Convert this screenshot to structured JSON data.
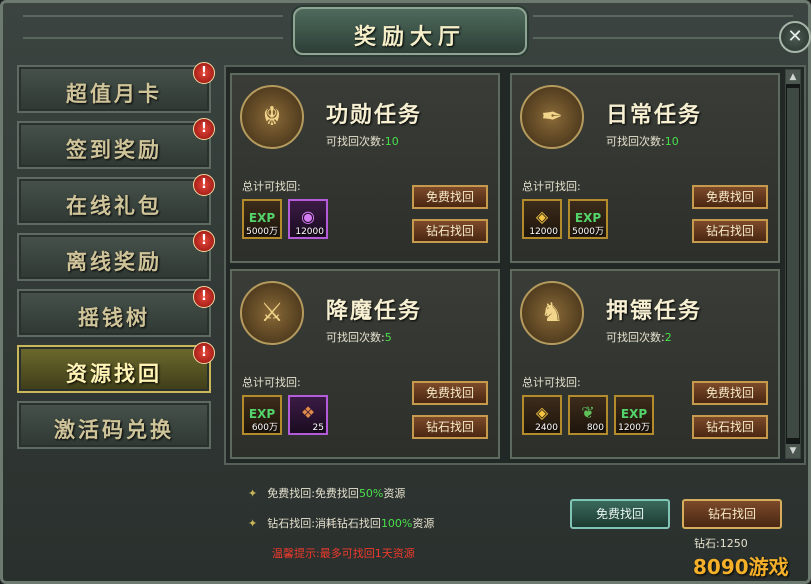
{
  "window": {
    "title": "奖励大厅",
    "close_glyph": "✕"
  },
  "sidebar": {
    "alert_glyph": "!",
    "items": [
      {
        "label": "超值月卡",
        "active": false
      },
      {
        "label": "签到奖励",
        "active": false
      },
      {
        "label": "在线礼包",
        "active": false
      },
      {
        "label": "离线奖励",
        "active": false
      },
      {
        "label": "摇钱树",
        "active": false
      },
      {
        "label": "资源找回",
        "active": true
      },
      {
        "label": "激活码兑换",
        "active": false
      }
    ]
  },
  "cards": [
    {
      "title": "功勋任务",
      "icon": "dragon-mask-icon",
      "count_label": "可找回次数:",
      "count": "10",
      "total_label": "总计可找回:",
      "rewards": [
        {
          "name": "exp-icon",
          "glyph": "EXP",
          "qty": "5000万",
          "frame": "gold"
        },
        {
          "name": "purple-orb-icon",
          "glyph": "◉",
          "qty": "12000",
          "frame": "purple"
        }
      ],
      "free_button": "免费找回",
      "diamond_button": "钻石找回"
    },
    {
      "title": "日常任务",
      "icon": "scroll-quill-icon",
      "count_label": "可找回次数:",
      "count": "10",
      "total_label": "总计可找回:",
      "rewards": [
        {
          "name": "gold-ingot-icon",
          "glyph": "◈",
          "qty": "12000",
          "frame": "gold"
        },
        {
          "name": "exp-icon",
          "glyph": "EXP",
          "qty": "5000万",
          "frame": "gold"
        }
      ],
      "free_button": "免费找回",
      "diamond_button": "钻石找回"
    },
    {
      "title": "降魔任务",
      "icon": "sword-scroll-icon",
      "count_label": "可找回次数:",
      "count": "5",
      "total_label": "总计可找回:",
      "rewards": [
        {
          "name": "exp-icon",
          "glyph": "EXP",
          "qty": "600万",
          "frame": "gold"
        },
        {
          "name": "purple-scroll-icon",
          "glyph": "❖",
          "qty": "25",
          "frame": "purple"
        }
      ],
      "free_button": "免费找回",
      "diamond_button": "钻石找回"
    },
    {
      "title": "押镖任务",
      "icon": "cargo-horse-icon",
      "count_label": "可找回次数:",
      "count": "2",
      "total_label": "总计可找回:",
      "rewards": [
        {
          "name": "gold-ingot-icon",
          "glyph": "◈",
          "qty": "2400",
          "frame": "gold"
        },
        {
          "name": "green-herb-icon",
          "glyph": "❦",
          "qty": "800",
          "frame": "gold"
        },
        {
          "name": "exp-icon",
          "glyph": "EXP",
          "qty": "1200万",
          "frame": "gold"
        }
      ],
      "free_button": "免费找回",
      "diamond_button": "钻石找回"
    }
  ],
  "footer": {
    "free_label": "免费找回:",
    "free_desc": "免费找回",
    "free_pct": "50%",
    "free_suffix": "资源",
    "diamond_label": "钻石找回:",
    "diamond_desc": "消耗钻石找回",
    "diamond_pct": "100%",
    "diamond_suffix": "资源",
    "tip_label": "温馨提示:",
    "tip_text": "最多可找回1天资源",
    "free_all_button": "免费找回",
    "diamond_all_button": "钻石找回",
    "diamond_count_label": "钻石:",
    "diamond_count": "1250"
  },
  "watermark": "8090游戏",
  "colors": {
    "accent_green": "#49e04a",
    "warning_red": "#f0392c",
    "gold": "#c59a4c"
  }
}
